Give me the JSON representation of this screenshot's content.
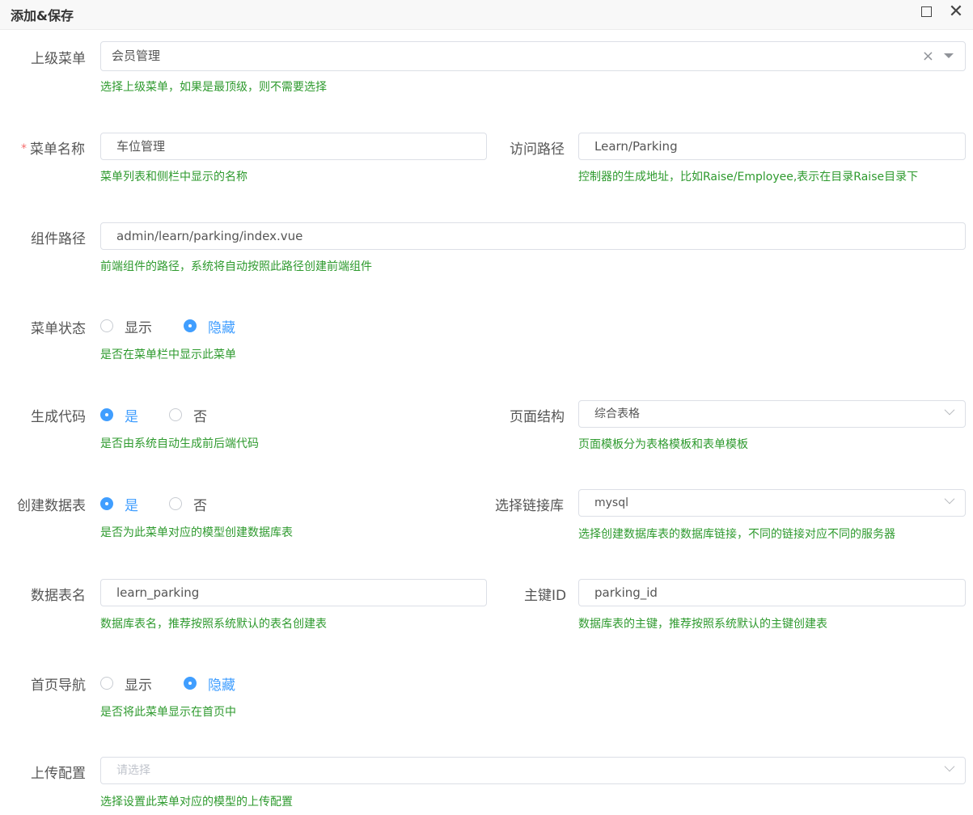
{
  "dialog": {
    "title": "添加&保存",
    "maximize_icon": "square-icon",
    "close_icon": "close-icon"
  },
  "fields": {
    "parent_menu": {
      "label": "上级菜单",
      "value": "会员管理",
      "hint": "选择上级菜单，如果是最顶级，则不需要选择",
      "clear": "×"
    },
    "menu_name": {
      "required_mark": "*",
      "label": "菜单名称",
      "value": "车位管理",
      "hint": "菜单列表和侧栏中显示的名称"
    },
    "route_path": {
      "label": "访问路径",
      "value": "Learn/Parking",
      "hint": "控制器的生成地址，比如Raise/Employee,表示在目录Raise目录下"
    },
    "component_path": {
      "label": "组件路径",
      "value": "admin/learn/parking/index.vue",
      "hint": "前端组件的路径，系统将自动按照此路径创建前端组件"
    },
    "menu_status": {
      "label": "菜单状态",
      "options": [
        "显示",
        "隐藏"
      ],
      "selected": "隐藏",
      "hint": "是否在菜单栏中显示此菜单"
    },
    "generate_code": {
      "label": "生成代码",
      "options": [
        "是",
        "否"
      ],
      "selected": "是",
      "hint": "是否由系统自动生成前后端代码"
    },
    "page_structure": {
      "label": "页面结构",
      "value": "综合表格",
      "hint": "页面模板分为表格模板和表单模板"
    },
    "create_table": {
      "label": "创建数据表",
      "options": [
        "是",
        "否"
      ],
      "selected": "是",
      "hint": "是否为此菜单对应的模型创建数据库表"
    },
    "db_connection": {
      "label": "选择链接库",
      "value": "mysql",
      "hint": "选择创建数据库表的数据库链接，不同的链接对应不同的服务器"
    },
    "table_name": {
      "label": "数据表名",
      "value": "learn_parking",
      "hint": "数据库表名，推荐按照系统默认的表名创建表"
    },
    "primary_key": {
      "label": "主键ID",
      "value": "parking_id",
      "hint": "数据库表的主键，推荐按照系统默认的主键创建表"
    },
    "home_nav": {
      "label": "首页导航",
      "options": [
        "显示",
        "隐藏"
      ],
      "selected": "隐藏",
      "hint": "是否将此菜单显示在首页中"
    },
    "upload_config": {
      "label": "上传配置",
      "placeholder": "请选择",
      "hint": "选择设置此菜单对应的模型的上传配置"
    }
  }
}
